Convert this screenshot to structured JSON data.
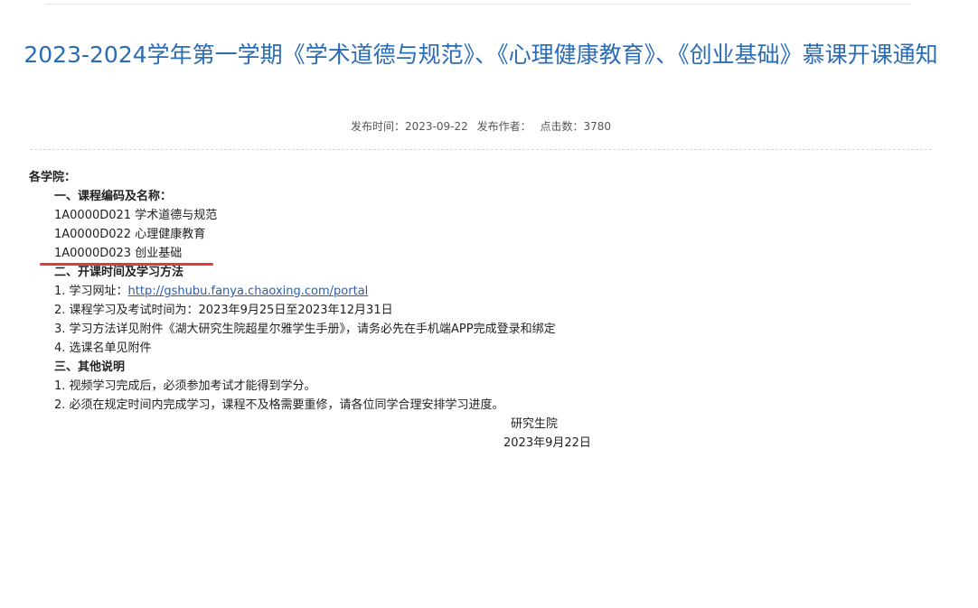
{
  "article": {
    "title": "2023-2024学年第一学期《学术道德与规范》、《心理健康教育》、《创业基础》慕课开课通知",
    "publish_time": "发布时间：2023-09-22",
    "author": "发布作者：",
    "views": "点击数：3780"
  },
  "body": {
    "greeting": "各学院：",
    "sec1_heading": "一、课程编码及名称：",
    "courses": [
      "1A0000D021 学术道德与规范",
      "1A0000D022 心理健康教育",
      "1A0000D023 创业基础"
    ],
    "sec2_heading": "二、开课时间及学习方法",
    "item1_prefix": "1. 学习网址：",
    "item1_link": "http://gshubu.fanya.chaoxing.com/portal",
    "item2": "2. 课程学习及考试时间为：2023年9月25日至2023年12月31日",
    "item3": "3. 学习方法详见附件《湖大研究生院超星尔雅学生手册》，请务必先在手机端APP完成登录和绑定",
    "item4": "4. 选课名单见附件",
    "sec3_heading": "三、其他说明",
    "note1": "1. 视频学习完成后，必须参加考试才能得到学分。",
    "note2": "2. 必须在规定时间内完成学习，课程不及格需要重修，请各位同学合理安排学习进度。",
    "signature": "研究生院",
    "sign_date": "2023年9月22日"
  },
  "colors": {
    "title": "#2a6cb5",
    "link": "#2a5db0",
    "annotation": "#e03a3a"
  }
}
